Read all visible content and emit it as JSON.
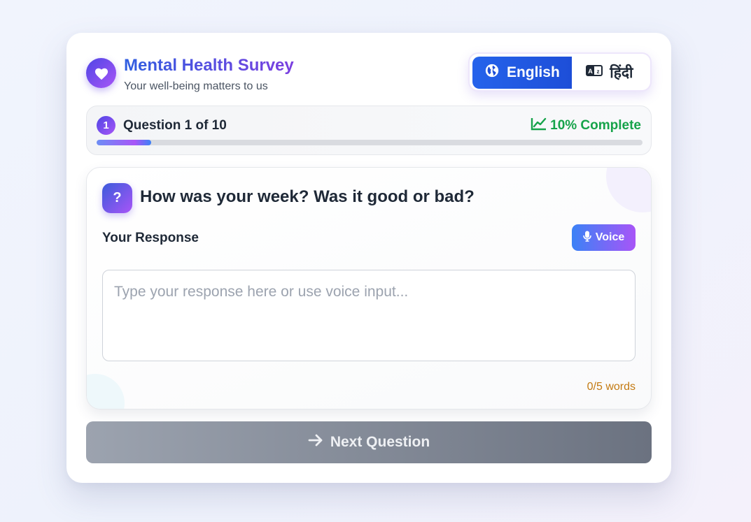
{
  "header": {
    "title": "Mental Health Survey",
    "subtitle": "Your well-being matters to us",
    "logo_icon": "heart-icon"
  },
  "language": {
    "options": [
      {
        "label": "English",
        "icon": "globe-icon",
        "selected": true
      },
      {
        "label": "हिंदी",
        "icon": "translate-icon",
        "selected": false
      }
    ]
  },
  "progress": {
    "step_number": "1",
    "label": "Question 1 of 10",
    "complete_text": "10% Complete",
    "fraction": 0.1,
    "icon": "chart-line-icon"
  },
  "question": {
    "icon_glyph": "?",
    "text": "How was your week? Was it good or bad?",
    "response_label": "Your Response",
    "voice_label": "Voice",
    "placeholder": "Type your response here or use voice input...",
    "value": "",
    "word_count": "0/5 words"
  },
  "actions": {
    "next_label": "Next Question",
    "next_icon": "arrow-right-icon"
  },
  "colors": {
    "accent_blue": "#2563eb",
    "accent_purple": "#a855f7",
    "success": "#16a34a",
    "warning_text": "#c47a12",
    "disabled_button": "#9ca3af"
  }
}
